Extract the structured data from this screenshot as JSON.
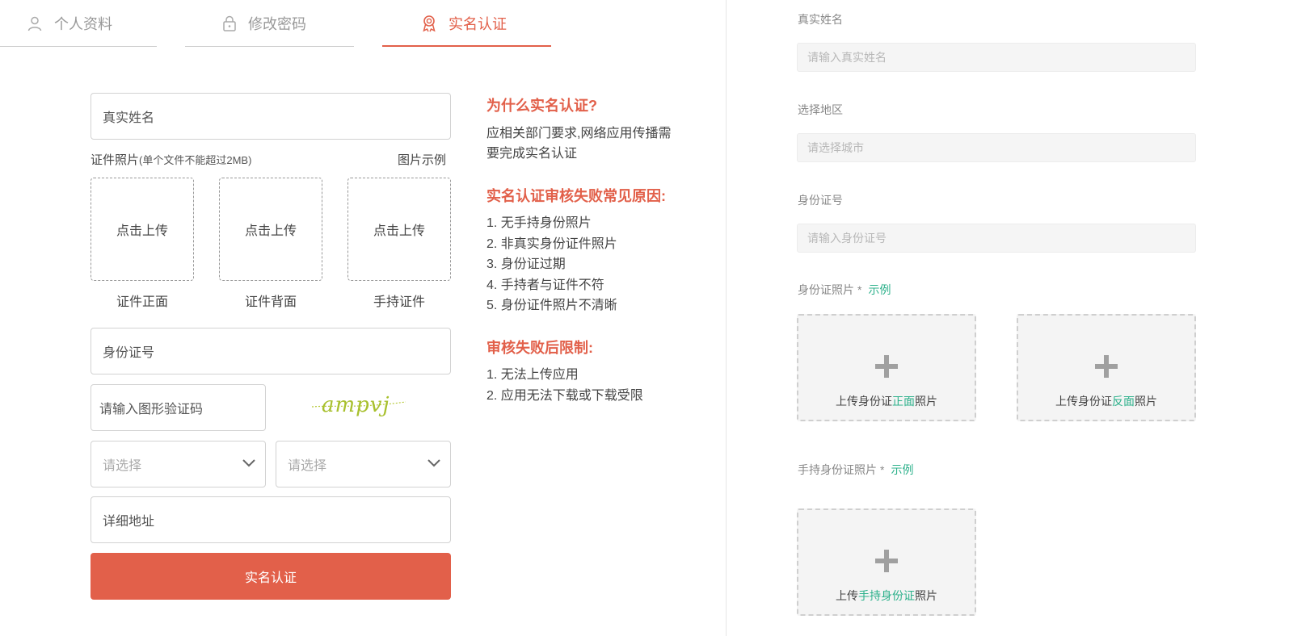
{
  "tabs": [
    {
      "label": "个人资料",
      "icon": "user-icon"
    },
    {
      "label": "修改密码",
      "icon": "lock-icon"
    },
    {
      "label": "实名认证",
      "icon": "badge-icon",
      "active": true
    }
  ],
  "form": {
    "real_name_placeholder": "真实姓名",
    "photo_label": "证件照片",
    "photo_hint": "(单个文件不能超过2MB)",
    "photo_example": "图片示例",
    "upload_text": "点击上传",
    "uploads": [
      {
        "caption": "证件正面"
      },
      {
        "caption": "证件背面"
      },
      {
        "caption": "手持证件"
      }
    ],
    "id_number_placeholder": "身份证号",
    "captcha_placeholder": "请输入图形验证码",
    "captcha_text": "ampvj",
    "select_1_placeholder": "请选择",
    "select_2_placeholder": "请选择",
    "address_placeholder": "详细地址",
    "submit_label": "实名认证"
  },
  "info": {
    "why_title": "为什么实名认证?",
    "why_lines": [
      "应相关部门要求,网络应用传播需",
      "要完成实名认证"
    ],
    "fail_title": "实名认证审核失败常见原因:",
    "fail_items": [
      "1. 无手持身份照片",
      "2. 非真实身份证件照片",
      "3. 身份证过期",
      "4. 手持者与证件不符",
      "5. 身份证件照片不清晰"
    ],
    "limit_title": "审核失败后限制:",
    "limit_items": [
      "1. 无法上传应用",
      "2. 应用无法下载或下载受限"
    ]
  },
  "right": {
    "name_label": "真实姓名",
    "name_placeholder": "请输入真实姓名",
    "region_label": "选择地区",
    "region_placeholder": "请选择城市",
    "id_label": "身份证号",
    "id_placeholder": "请输入身份证号",
    "id_photo_label": "身份证照片",
    "hand_photo_label": "手持身份证照片",
    "required_mark": "*",
    "example_link": "示例",
    "upload_prefix": "上传身份证",
    "upload_suffix": "照片",
    "front_word": "正面",
    "back_word": "反面",
    "hand_prefix": "上传",
    "hand_word": "手持身份证",
    "hand_suffix": "照片"
  },
  "colors": {
    "accent": "#e2604a",
    "green": "#2bb08a"
  }
}
